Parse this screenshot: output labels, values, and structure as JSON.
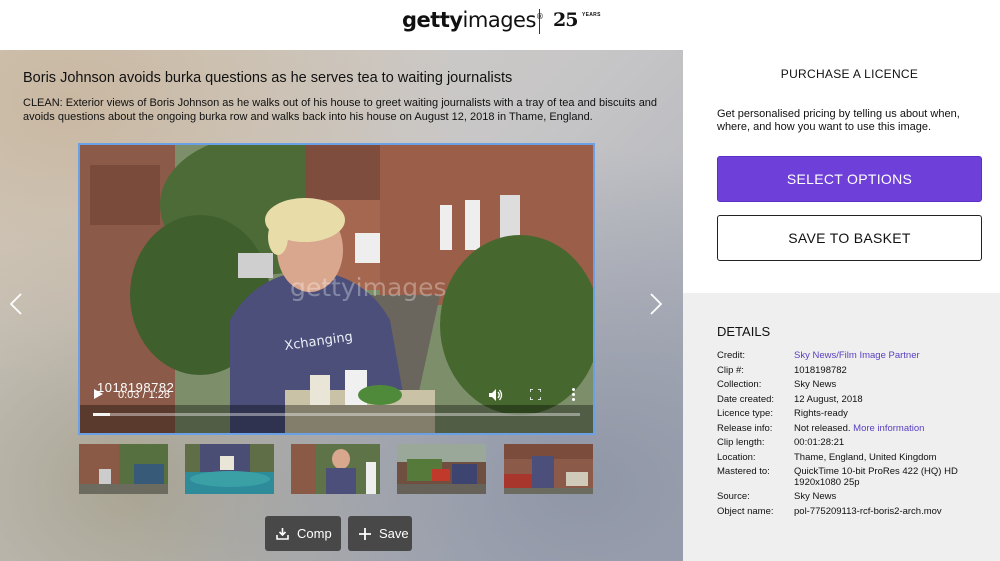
{
  "brand": {
    "logo_bold": "getty",
    "logo_light": "images",
    "trademark": "®",
    "anniversary": "25",
    "anniversary_sub": "YEARS"
  },
  "asset": {
    "title": "Boris Johnson avoids burka questions as he serves tea to waiting journalists",
    "description": "CLEAN: Exterior views of Boris Johnson as he walks out of his house to greet waiting journalists with a tray of tea and biscuits and avoids questions about the ongoing burka row and walks back into his house on August 12, 2018 in Thame, England.",
    "watermark": "gettyimages",
    "clip_overlay_number": "1018198782"
  },
  "player": {
    "time_display": "0:03 / 1:28",
    "progress_fraction": 0.034,
    "icons": [
      "play-icon",
      "volume-icon",
      "fullscreen-icon",
      "more-options-icon"
    ]
  },
  "thumbnails": [
    {
      "label": "thumbnail-1"
    },
    {
      "label": "thumbnail-2"
    },
    {
      "label": "thumbnail-3"
    },
    {
      "label": "thumbnail-4"
    },
    {
      "label": "thumbnail-5"
    }
  ],
  "actions": {
    "comp_label": "Comp",
    "save_label": "Save"
  },
  "purchase": {
    "heading": "PURCHASE A LICENCE",
    "pricing_text": "Get personalised pricing by telling us about when, where, and how you want to use this image.",
    "select_label": "SELECT OPTIONS",
    "basket_label": "SAVE TO BASKET",
    "accent_color": "#6e3fd9"
  },
  "details": {
    "heading": "DETAILS",
    "credit_label": "Credit:",
    "credit_value": "Sky News/Film Image Partner",
    "clip_label": "Clip #:",
    "clip_value": "1018198782",
    "collection_label": "Collection:",
    "collection_value": "Sky News",
    "date_label": "Date created:",
    "date_value": "12 August, 2018",
    "licence_label": "Licence type:",
    "licence_value": "Rights-ready",
    "release_label": "Release info:",
    "release_value": "Not released.",
    "release_link": "More information",
    "length_label": "Clip length:",
    "length_value": "00:01:28:21",
    "location_label": "Location:",
    "location_value": "Thame, England, United Kingdom",
    "mastered_label": "Mastered to:",
    "mastered_value_1": "QuickTime 10-bit ProRes 422 (HQ) HD",
    "mastered_value_2": "1920x1080 25p",
    "source_label": "Source:",
    "source_value": "Sky News",
    "object_label": "Object name:",
    "object_value": "pol-775209113-rcf-boris2-arch.mov"
  }
}
